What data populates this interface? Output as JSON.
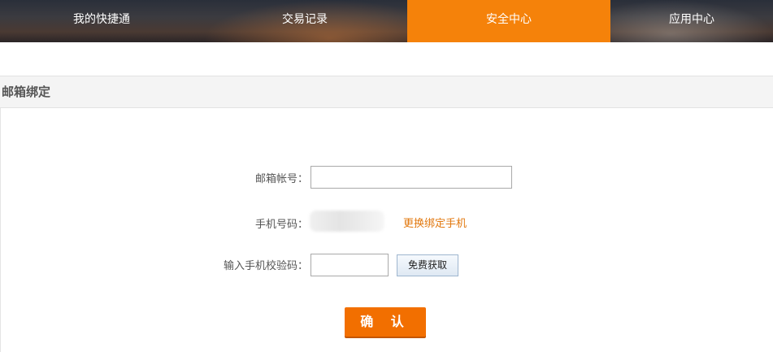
{
  "nav": {
    "items": [
      {
        "label": "我的快捷通",
        "active": false
      },
      {
        "label": "交易记录",
        "active": false
      },
      {
        "label": "安全中心",
        "active": true
      },
      {
        "label": "应用中心",
        "active": false
      }
    ],
    "active_color": "#f5820a"
  },
  "section": {
    "title": "邮箱绑定"
  },
  "form": {
    "email_label": "邮箱帐号：",
    "email_value": "",
    "phone_label": "手机号码：",
    "change_phone_link": "更换绑定手机",
    "code_label": "输入手机校验码：",
    "code_value": "",
    "get_code_button": "免费获取",
    "confirm_button": "确 认"
  },
  "colors": {
    "link": "#e2780e",
    "confirm": "#f26f00"
  }
}
